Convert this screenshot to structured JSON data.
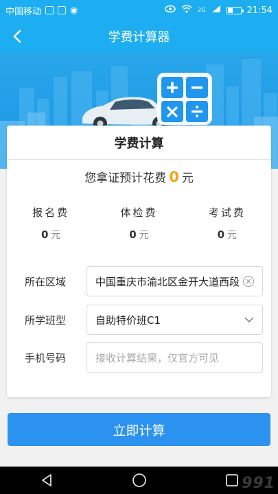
{
  "status_bar": {
    "carrier": "中国移动",
    "time": "21:54",
    "network": "2G"
  },
  "nav": {
    "title": "学费计算器",
    "back_icon": "chevron-left-icon"
  },
  "banner": {
    "icons": [
      "plus-icon",
      "minus-icon",
      "times-icon",
      "divide-icon"
    ]
  },
  "card": {
    "title": "学费计算",
    "estimate": {
      "prefix": "您拿证预计花费",
      "value": "0",
      "unit": "元"
    },
    "fees": [
      {
        "label": "报名费",
        "value": "0",
        "unit": "元"
      },
      {
        "label": "体检费",
        "value": "0",
        "unit": "元"
      },
      {
        "label": "考试费",
        "value": "0",
        "unit": "元"
      }
    ],
    "form": {
      "area": {
        "label": "所在区域",
        "value": "中国重庆市渝北区金开大道西段"
      },
      "class": {
        "label": "所学班型",
        "value": "自助特价班C1"
      },
      "phone": {
        "label": "手机号码",
        "placeholder": "接收计算结果，仅官方可见"
      }
    }
  },
  "submit": {
    "label": "立即计算"
  },
  "watermark": "991"
}
